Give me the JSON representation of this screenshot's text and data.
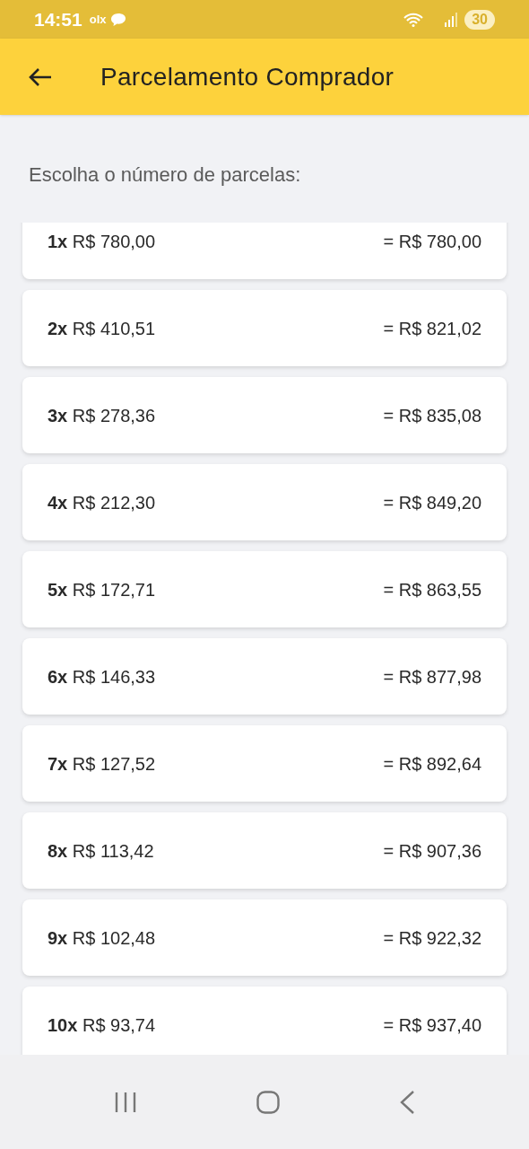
{
  "status_bar": {
    "time": "14:51",
    "app_label": "olx",
    "battery": "30"
  },
  "header": {
    "title": "Parcelamento Comprador"
  },
  "prompt": "Escolha o número de parcelas:",
  "installments": [
    {
      "label": "**1x** R$ 780,00",
      "total": "= R$ 780,00"
    },
    {
      "label": "**2x** R$ 410,51",
      "total": "= R$ 821,02"
    },
    {
      "label": "**3x** R$ 278,36",
      "total": "= R$ 835,08"
    },
    {
      "label": "**4x** R$ 212,30",
      "total": "= R$ 849,20"
    },
    {
      "label": "**5x** R$ 172,71",
      "total": "= R$ 863,55"
    },
    {
      "label": "**6x** R$ 146,33",
      "total": "= R$ 877,98"
    },
    {
      "label": "**7x** R$ 127,52",
      "total": "= R$ 892,64"
    },
    {
      "label": "**8x** R$ 113,42",
      "total": "= R$ 907,36"
    },
    {
      "label": "**9x** R$ 102,48",
      "total": "= R$ 922,32"
    },
    {
      "label": "**10x** R$ 93,74",
      "total": "= R$ 937,40"
    }
  ]
}
